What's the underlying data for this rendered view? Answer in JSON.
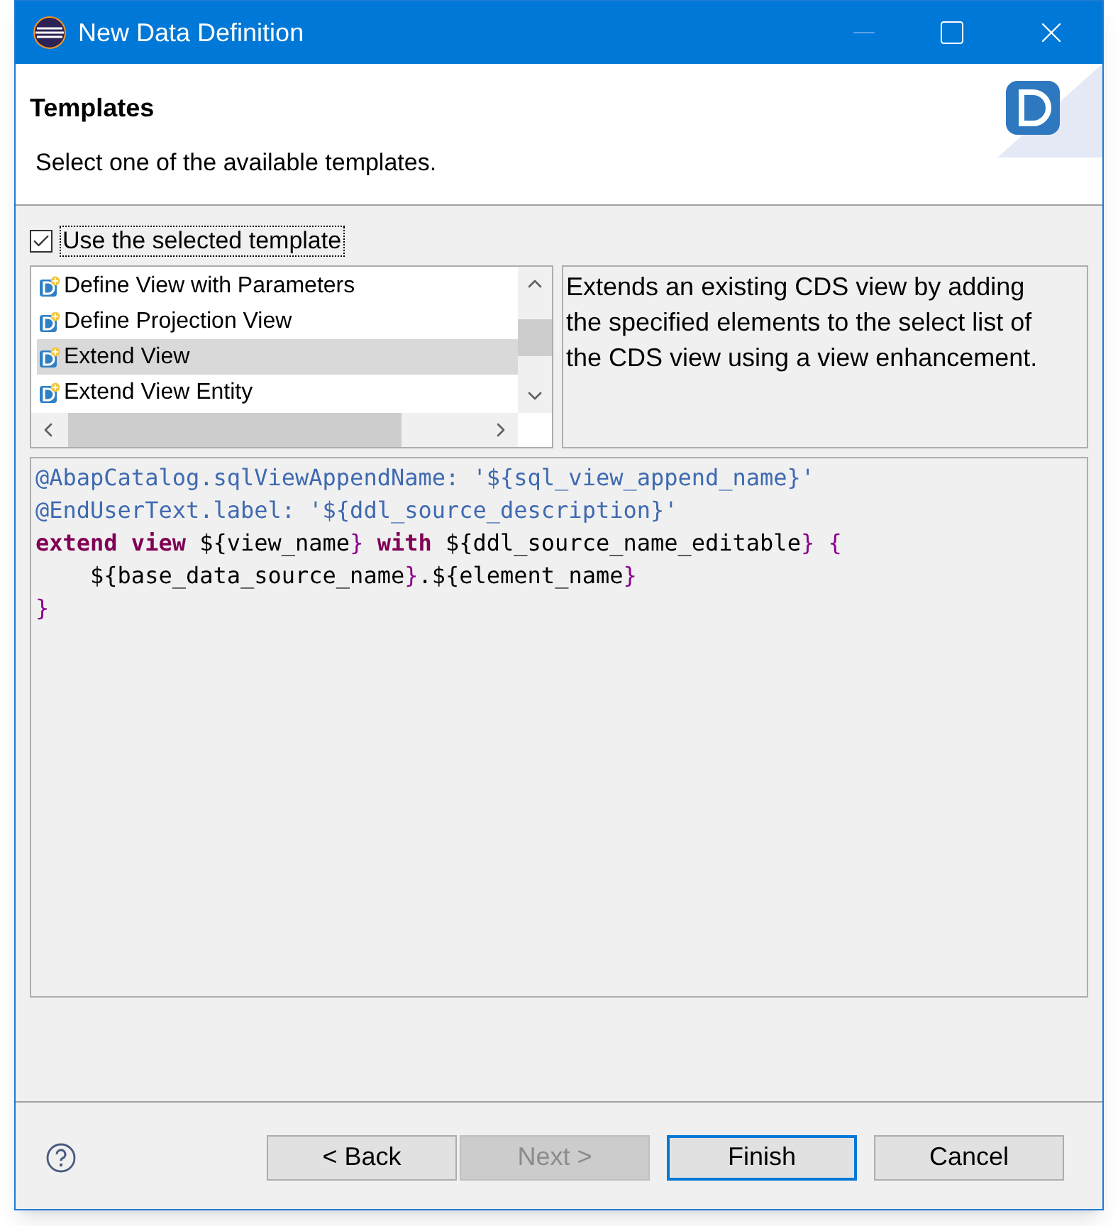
{
  "window": {
    "title": "New Data Definition"
  },
  "header": {
    "title": "Templates",
    "description": "Select one of the available templates."
  },
  "use_template": {
    "label": "Use the selected template",
    "checked": true
  },
  "templates": [
    {
      "label": "Define View with Parameters",
      "selected": false
    },
    {
      "label": "Define Projection View",
      "selected": false
    },
    {
      "label": "Extend View",
      "selected": true
    },
    {
      "label": "Extend View Entity",
      "selected": false
    }
  ],
  "template_description": "Extends an existing CDS view by adding the specified elements to the select list of the CDS view using a view enhancement.",
  "code": [
    [
      {
        "kind": "annotation",
        "text": "@AbapCatalog.sqlViewAppendName: '${sql_view_append_name}'"
      }
    ],
    [
      {
        "kind": "annotation",
        "text": "@EndUserText.label: '${ddl_source_description}'"
      }
    ],
    [
      {
        "kind": "keyword",
        "text": "extend view"
      },
      {
        "kind": "plain",
        "text": " ${view_name"
      },
      {
        "kind": "brace",
        "text": "} "
      },
      {
        "kind": "keyword",
        "text": "with"
      },
      {
        "kind": "plain",
        "text": " ${ddl_source_name_editable"
      },
      {
        "kind": "brace",
        "text": "} {"
      }
    ],
    [
      {
        "kind": "plain",
        "text": "    ${base_data_source_name"
      },
      {
        "kind": "brace",
        "text": "}"
      },
      {
        "kind": "plain",
        "text": ".${element_name"
      },
      {
        "kind": "brace",
        "text": "}"
      }
    ],
    [
      {
        "kind": "brace",
        "text": "}"
      }
    ]
  ],
  "buttons": [
    {
      "label": "< Back",
      "disabled": false,
      "default": false
    },
    {
      "label": "Next >",
      "disabled": true,
      "default": false
    },
    {
      "label": "Finish",
      "disabled": false,
      "default": true
    },
    {
      "label": "Cancel",
      "disabled": false,
      "default": false
    }
  ]
}
